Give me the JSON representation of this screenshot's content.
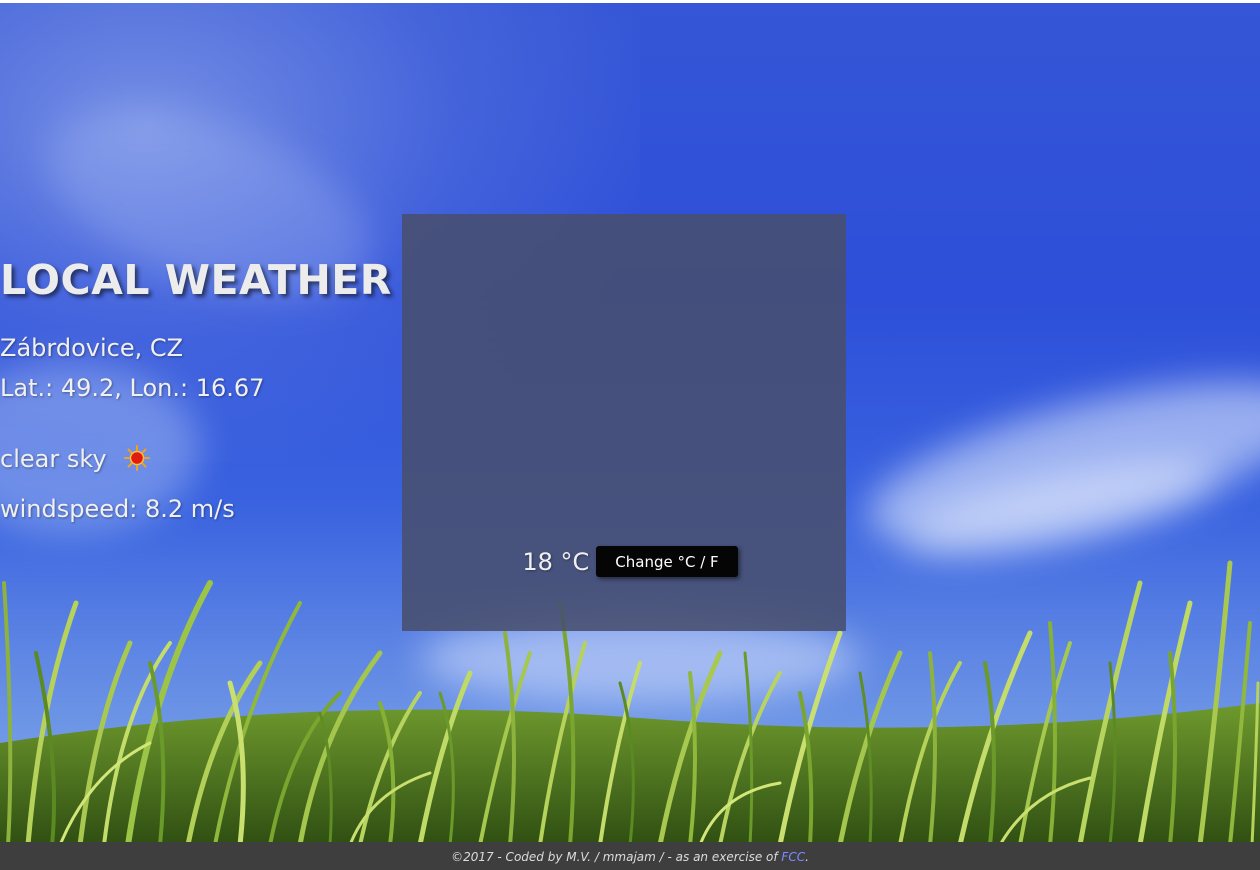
{
  "app": {
    "title": "LOCAL WEATHER"
  },
  "weather": {
    "location": "Zábrdovice, CZ",
    "coordinates": "Lat.: 49.2, Lon.: 16.67",
    "condition": "clear sky",
    "condition_icon": "sun-icon",
    "windspeed": "windspeed: 8.2 m/s",
    "temperature": "18 °C",
    "unit_button_label": "Change °C / F"
  },
  "footer": {
    "text": "©2017 - Coded by M.V. / mmajam / - as an exercise of ",
    "link_label": "FCC",
    "suffix": ".",
    "link_color": "#7a8cff"
  },
  "colors": {
    "panel": "#484e6e",
    "button": "#050505",
    "footer": "#3e3e3e",
    "sky": "#2d4fd9"
  }
}
